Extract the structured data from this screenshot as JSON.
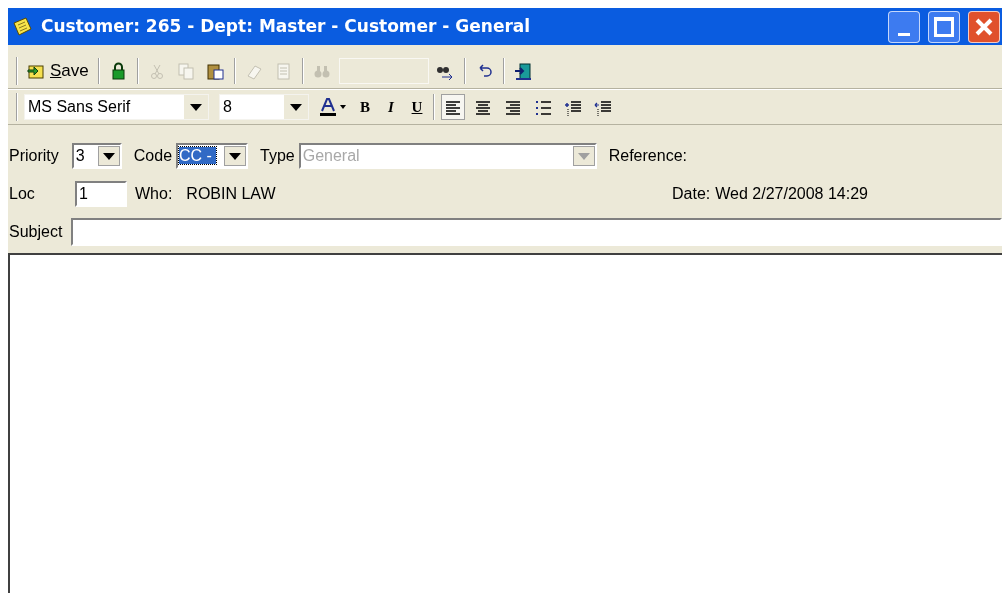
{
  "window": {
    "title": "Customer: 265 - Dept: Master - Customer - General"
  },
  "toolbar": [
    {
      "kind": "button",
      "label": "Save",
      "disabled": false
    },
    {
      "kind": "separator"
    },
    {
      "kind": "button",
      "disabled": false
    },
    {
      "kind": "separator"
    },
    {
      "kind": "button",
      "disabled": true
    },
    {
      "kind": "button",
      "disabled": true
    },
    {
      "kind": "button",
      "disabled": false
    },
    {
      "kind": "separator"
    },
    {
      "kind": "button",
      "disabled": true
    },
    {
      "kind": "button",
      "disabled": true
    },
    {
      "kind": "separator"
    },
    {
      "kind": "button",
      "disabled": true
    },
    {
      "kind": "field",
      "disabled": true
    },
    {
      "kind": "button",
      "disabled": false
    },
    {
      "kind": "separator"
    },
    {
      "kind": "button",
      "disabled": false
    },
    {
      "kind": "separator"
    },
    {
      "kind": "button",
      "disabled": false
    }
  ],
  "format_bar": {
    "font": "MS Sans Serif",
    "size": "8",
    "buttons": [
      {
        "kind": "color",
        "selected": false
      },
      {
        "kind": "glyph",
        "label": "B",
        "selected": false
      },
      {
        "kind": "glyph",
        "label": "I",
        "selected": false
      },
      {
        "kind": "glyph",
        "label": "U",
        "selected": false
      },
      {
        "kind": "separator"
      },
      {
        "kind": "align",
        "selected": true
      },
      {
        "kind": "align",
        "selected": false
      },
      {
        "kind": "align",
        "selected": false
      },
      {
        "kind": "bullets",
        "selected": false
      },
      {
        "kind": "indent",
        "selected": false
      },
      {
        "kind": "outdent",
        "selected": false
      }
    ]
  },
  "form": {
    "priority_label": "Priority",
    "priority": "3",
    "code_label": "Code",
    "code": "CC - ",
    "type_label": "Type",
    "type": "General",
    "type_disabled": true,
    "reference_label": "Reference:",
    "loc_label": "Loc",
    "loc": "1",
    "who_label": "Who:",
    "who": "ROBIN LAW",
    "date_label": "Date:",
    "date": "Wed 2/27/2008 14:29",
    "subject_label": "Subject"
  }
}
